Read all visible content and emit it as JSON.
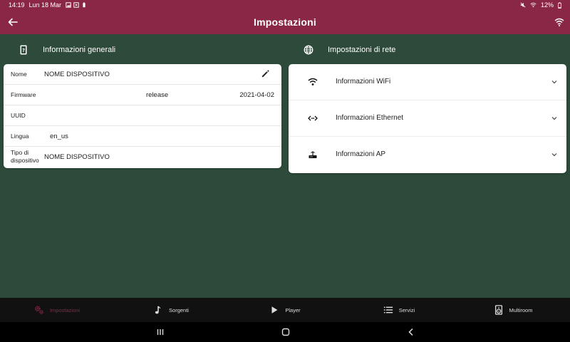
{
  "status_bar": {
    "time": "14:19",
    "date": "Lun 18 Mar",
    "battery": "12%"
  },
  "app_bar": {
    "title": "Impostazioni"
  },
  "general": {
    "header": "Informazioni generali",
    "rows": {
      "name": {
        "label": "Nome",
        "value": "NOME DISPOSITIVO"
      },
      "firmware": {
        "label": "Firmware",
        "channel": "release",
        "date": "2021-04-02"
      },
      "uuid": {
        "label": "UUID",
        "value": ""
      },
      "language": {
        "label": "Lingua",
        "value": "en_us"
      },
      "device_type": {
        "label_line1": "Tipo di",
        "label_line2": "dispositivo",
        "value": "NOME DISPOSITIVO"
      }
    }
  },
  "network": {
    "header": "Impostazioni di rete",
    "items": [
      {
        "label": "Informazioni WiFi",
        "icon": "wifi-icon"
      },
      {
        "label": "Informazioni Ethernet",
        "icon": "ethernet-icon"
      },
      {
        "label": "Informazioni AP",
        "icon": "router-icon"
      }
    ]
  },
  "bottom_nav": {
    "items": [
      {
        "label": "Impostazioni",
        "icon": "gears-icon",
        "active": true
      },
      {
        "label": "Sorgenti",
        "icon": "music-note-icon",
        "active": false
      },
      {
        "label": "Player",
        "icon": "play-icon",
        "active": false
      },
      {
        "label": "Servizi",
        "icon": "list-icon",
        "active": false
      },
      {
        "label": "Multiroom",
        "icon": "speaker-icon",
        "active": false
      }
    ]
  },
  "colors": {
    "primary": "#8b2746",
    "background": "#2d4a3a",
    "card": "#ffffff",
    "nav_bg": "#111111"
  }
}
